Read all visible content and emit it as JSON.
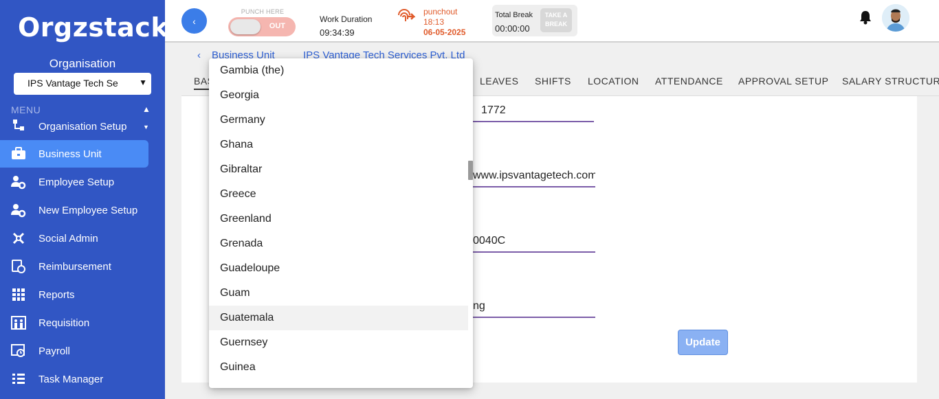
{
  "sidebar": {
    "logo": "Orgzstack",
    "org_label": "Organisation",
    "org_selected": "IPS Vantage Tech Se",
    "menu_label": "MENU",
    "items": [
      {
        "label": "Organisation Setup",
        "icon": "org-setup-icon"
      },
      {
        "label": "Business Unit",
        "icon": "briefcase-icon",
        "active": true
      },
      {
        "label": "Employee Setup",
        "icon": "users-gear-icon"
      },
      {
        "label": "New Employee Setup",
        "icon": "users-gear-icon"
      },
      {
        "label": "Social Admin",
        "icon": "social-icon"
      },
      {
        "label": "Reimbursement",
        "icon": "reimbursement-icon"
      },
      {
        "label": "Reports",
        "icon": "reports-icon"
      },
      {
        "label": "Requisition",
        "icon": "requisition-icon"
      },
      {
        "label": "Payroll",
        "icon": "payroll-icon"
      },
      {
        "label": "Task Manager",
        "icon": "task-icon"
      }
    ]
  },
  "header": {
    "punch_label": "PUNCH HERE",
    "punch_toggle": "OUT",
    "work_duration_label": "Work Duration",
    "work_duration": "09:34:39",
    "punch_status": "punchout",
    "punch_time": "18:13",
    "punch_date": "06-05-2025",
    "break_label": "Total Break",
    "break_value": "00:00:00",
    "break_button": "TAKE A BREAK"
  },
  "breadcrumb": {
    "first": "Business Unit",
    "second": "IPS Vantage Tech Services Pvt. Ltd"
  },
  "tabs": [
    "BAS",
    "LEAVES",
    "SHIFTS",
    "LOCATION",
    "ATTENDANCE",
    "APPROVAL SETUP",
    "SALARY STRUCTURE"
  ],
  "fields": {
    "f1": "1772",
    "f2": "www.ipsvantagetech.com/",
    "f3": "0040C",
    "f4": "ng"
  },
  "update_label": "Update",
  "dropdown": {
    "options": [
      "Gambia (the)",
      "Georgia",
      "Germany",
      "Ghana",
      "Gibraltar",
      "Greece",
      "Greenland",
      "Grenada",
      "Guadeloupe",
      "Guam",
      "Guatemala",
      "Guernsey",
      "Guinea"
    ],
    "highlighted": "Guatemala"
  }
}
